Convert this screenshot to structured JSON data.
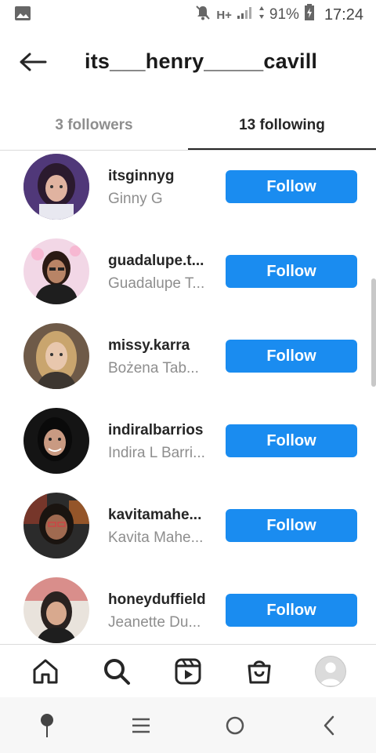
{
  "status_bar": {
    "network": "H+",
    "battery": "91%",
    "time": "17:24"
  },
  "header": {
    "title": "its___henry_____cavill"
  },
  "tabs": [
    {
      "label": "3 followers",
      "active": false
    },
    {
      "label": "13 following",
      "active": true
    }
  ],
  "following": [
    {
      "username": "itsginnyg",
      "full_name": "Ginny G",
      "button": "Follow"
    },
    {
      "username": "guadalupe.t...",
      "full_name": "Guadalupe T...",
      "button": "Follow"
    },
    {
      "username": "missy.karra",
      "full_name": "Bożena Tab...",
      "button": "Follow"
    },
    {
      "username": "indiralbarrios",
      "full_name": "Indira L Barri...",
      "button": "Follow"
    },
    {
      "username": "kavitamahe...",
      "full_name": "Kavita Mahe...",
      "button": "Follow"
    },
    {
      "username": "honeyduffield",
      "full_name": "Jeanette Du...",
      "button": "Follow"
    }
  ],
  "bottom_nav": [
    "home-icon",
    "search-icon",
    "reels-icon",
    "shop-icon",
    "profile-avatar"
  ],
  "system_nav": [
    "assistant-icon",
    "recents-icon",
    "home-circle-icon",
    "back-chevron-icon"
  ],
  "colors": {
    "follow_button": "#1a8cf0",
    "text_primary": "#262626",
    "text_secondary": "#8e8e8e"
  }
}
